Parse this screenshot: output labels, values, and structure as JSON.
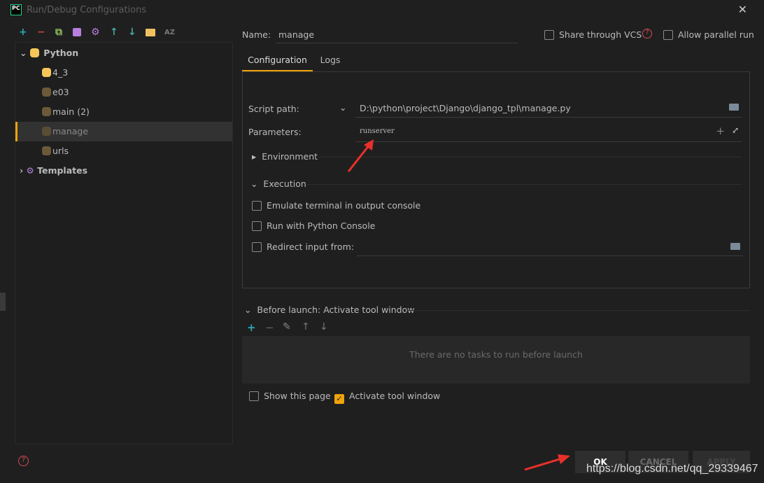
{
  "window": {
    "title": "Run/Debug Configurations",
    "logo_text": "PC"
  },
  "tree": {
    "root": "Python",
    "items": [
      "4_3",
      "e03",
      "main (2)",
      "manage",
      "urls"
    ],
    "selected": "manage",
    "templates": "Templates"
  },
  "form": {
    "name_label": "Name:",
    "name_value": "manage",
    "share_vcs": "Share through VCS",
    "allow_parallel": "Allow parallel run",
    "tabs": [
      "Configuration",
      "Logs"
    ],
    "script_path_label": "Script path:",
    "script_path_value": "D:\\python\\project\\Django\\django_tpl\\manage.py",
    "parameters_label": "Parameters:",
    "parameters_value": "runserver",
    "environment": "Environment",
    "execution": "Execution",
    "emulate_terminal": "Emulate terminal in output console",
    "run_python_console": "Run with Python Console",
    "redirect_input": "Redirect input from:",
    "before_launch": "Before launch: Activate tool window",
    "no_tasks": "There are no tasks to run before launch",
    "show_page": "Show this page",
    "activate_tool_window": "Activate tool window"
  },
  "buttons": {
    "ok": "OK",
    "cancel": "CANCEL",
    "apply": "APPLY"
  },
  "watermark": "https://blog.csdn.net/qq_29339467",
  "colors": {
    "accent": "#f0a30a",
    "background": "#1f1f1f",
    "annotation_arrow": "#e8302a"
  }
}
